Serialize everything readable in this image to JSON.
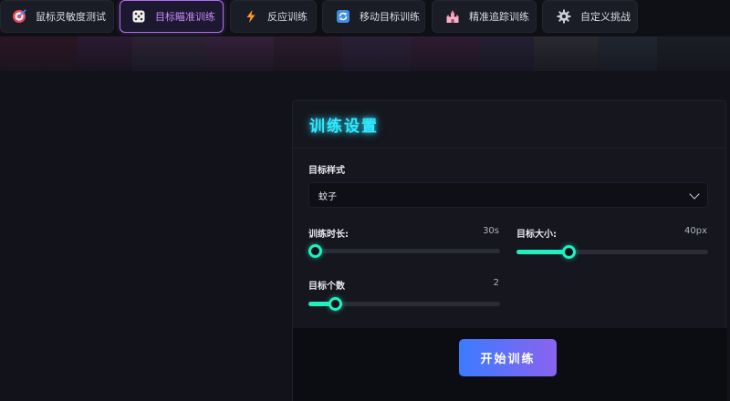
{
  "tabs": [
    {
      "label": "鼠标灵敏度测试",
      "icon": "target-dart-icon",
      "active": false
    },
    {
      "label": "目标瞄准训练",
      "icon": "dice-icon",
      "active": true
    },
    {
      "label": "反应训练",
      "icon": "lightning-icon",
      "active": false
    },
    {
      "label": "移动目标训练",
      "icon": "refresh-icon",
      "active": false
    },
    {
      "label": "精准追踪训练",
      "icon": "castle-icon",
      "active": false
    },
    {
      "label": "自定义挑战",
      "icon": "gear-icon",
      "active": false
    }
  ],
  "colors": {
    "accent_purple": "#b46cf0",
    "title_cyan": "#31e8ff",
    "slider_green": "#1ff0c0",
    "button_from": "#3b7bff",
    "button_to": "#8a63f0"
  },
  "settings": {
    "title": "训练设置",
    "target_style": {
      "label": "目标样式",
      "value": "蚊子"
    },
    "duration": {
      "label": "训练时长:",
      "value_text": "30s",
      "level": 0.0
    },
    "size": {
      "label": "目标大小:",
      "value_text": "40px",
      "level": 0.27
    },
    "count": {
      "label": "目标个数",
      "value_text": "2",
      "level": 0.14
    },
    "start_label": "开始训练"
  }
}
